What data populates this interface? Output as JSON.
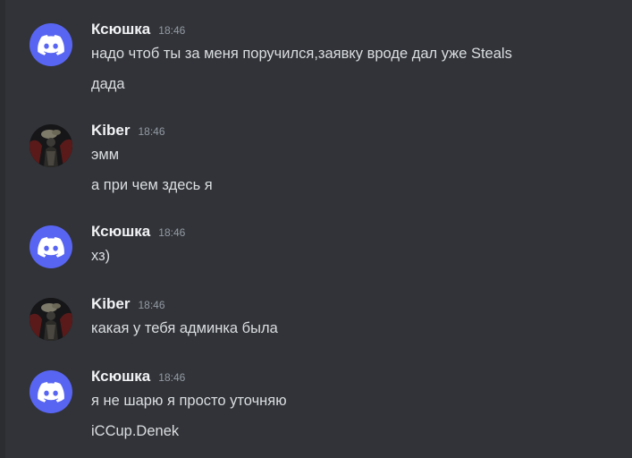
{
  "messages": [
    {
      "username": "Ксюшка",
      "time": "18:46",
      "avatar": "discord-logo-icon",
      "lines": [
        "надо чтоб ты за меня поручился,заявку вроде дал уже Steals",
        "дада"
      ]
    },
    {
      "username": "Kiber",
      "time": "18:46",
      "avatar": "user-avatar-image",
      "lines": [
        "эмм",
        "а при чем здесь я"
      ]
    },
    {
      "username": "Ксюшка",
      "time": "18:46",
      "avatar": "discord-logo-icon",
      "lines": [
        "хз)"
      ]
    },
    {
      "username": "Kiber",
      "time": "18:46",
      "avatar": "user-avatar-image",
      "lines": [
        "какая у тебя админка была"
      ]
    },
    {
      "username": "Ксюшка",
      "time": "18:46",
      "avatar": "discord-logo-icon",
      "lines": [
        "я не шарю я просто уточняю",
        "iCCup.Denek"
      ]
    }
  ],
  "colors": {
    "background": "#313338",
    "discord_blurple": "#5865f2",
    "username": "#f2f3f5",
    "message_text": "#dbdee1",
    "timestamp": "#949ba4"
  }
}
